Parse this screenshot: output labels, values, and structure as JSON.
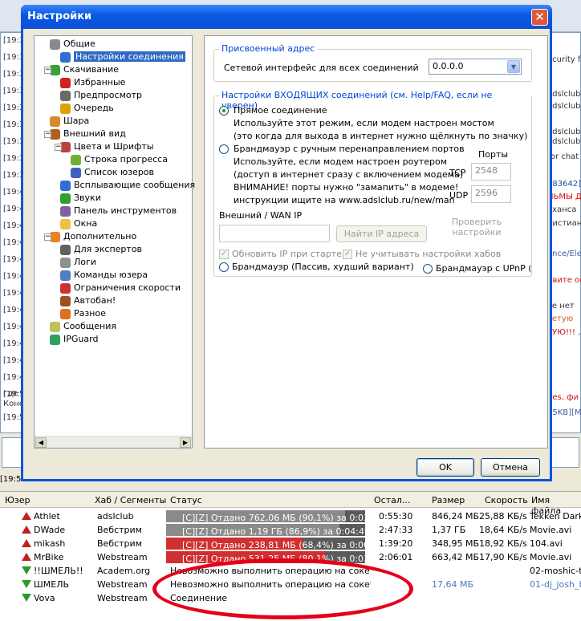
{
  "window": {
    "title": "Настройки",
    "close_glyph": "✕"
  },
  "tree": {
    "items": [
      {
        "label": "Общие",
        "icon": "users-icon",
        "color": "#8a8a8a"
      },
      {
        "label": "Настройки соединения",
        "icon": "network-icon",
        "color": "#2e6fd0",
        "selected": true
      },
      {
        "label": "Скачивание",
        "icon": "download-icon",
        "color": "#3aa03a"
      },
      {
        "label": "Избранные",
        "icon": "heart-icon",
        "color": "#d02020"
      },
      {
        "label": "Предпросмотр",
        "icon": "preview-icon",
        "color": "#6a6a6a"
      },
      {
        "label": "Очередь",
        "icon": "queue-icon",
        "color": "#e0a000"
      },
      {
        "label": "Шара",
        "icon": "share-icon",
        "color": "#d88a2a"
      },
      {
        "label": "Внешний вид",
        "icon": "appearance-icon",
        "color": "#b06020"
      },
      {
        "label": "Цвета и Шрифты",
        "icon": "palette-icon",
        "color": "#c04040"
      },
      {
        "label": "Строка прогресса",
        "icon": "progress-icon",
        "color": "#70b030"
      },
      {
        "label": "Список юзеров",
        "icon": "userlist-icon",
        "color": "#4060c0"
      },
      {
        "label": "Всплывающие сообщения",
        "icon": "popup-icon",
        "color": "#3070d0"
      },
      {
        "label": "Звуки",
        "icon": "sound-icon",
        "color": "#30a030"
      },
      {
        "label": "Панель инструментов",
        "icon": "toolbar-icon",
        "color": "#8060a0"
      },
      {
        "label": "Окна",
        "icon": "windows-icon",
        "color": "#f0c040"
      },
      {
        "label": "Дополнительно",
        "icon": "advanced-icon",
        "color": "#f08020"
      },
      {
        "label": "Для экспертов",
        "icon": "expert-icon",
        "color": "#606060"
      },
      {
        "label": "Логи",
        "icon": "logs-icon",
        "color": "#909090"
      },
      {
        "label": "Команды юзера",
        "icon": "commands-icon",
        "color": "#5080c0"
      },
      {
        "label": "Ограничения скорости",
        "icon": "speed-limit-icon",
        "color": "#d03030"
      },
      {
        "label": "Автобан!",
        "icon": "autoban-icon",
        "color": "#a05020"
      },
      {
        "label": "Разное",
        "icon": "misc-icon",
        "color": "#e07020"
      },
      {
        "label": "Сообщения",
        "icon": "messages-icon",
        "color": "#c0c060"
      },
      {
        "label": "IPGuard",
        "icon": "ipguard-icon",
        "color": "#30a060"
      }
    ]
  },
  "assigned": {
    "title": "Присвоенный адрес",
    "iface_label": "Сетевой интерфейс для всех соединений",
    "iface_value": "0.0.0.0"
  },
  "incoming": {
    "title": "Настройки ВХОДЯЩИХ соединений (см. Help/FAQ, если не уверен)",
    "direct_label": "Прямое соединение",
    "direct_desc1": "Используйте этот режим, если модем настроен мостом",
    "direct_desc2": "(это когда для выхода в интернет нужно щёлкнуть по значку)",
    "firewall_manual_label": "Брандмауэр с ручным перенаправлением портов",
    "fw_desc1": "Используйте, если модем настроен роутером",
    "fw_desc2": "(доступ в интернет сразу с включением модема)",
    "fw_desc3": "ВНИМАНИЕ! порты нужно \"замапить\" в модеме!",
    "fw_desc4": "инструкции ищите на www.adslclub.ru/new/man",
    "ports_label": "Порты",
    "tcp_label": "TCP",
    "tcp_value": "2548",
    "udp_label": "UDP",
    "udp_value": "2596",
    "wan_label": "Внешний / WAN IP",
    "wan_value": "",
    "find_ip_button": "Найти IP адреса",
    "check_settings_button": "Проверить настройки",
    "update_ip_label": "Обновить IP при старте",
    "ignore_hubs_label": "Не учитывать настройки хабов",
    "passive_label": "Брандмауэр (Пассив, худший вариант)",
    "upnp_label": "Брандмауэр с UPnP ("
  },
  "buttons": {
    "ok": "OK",
    "cancel": "Отмена"
  },
  "transfers": {
    "columns": [
      "Юзер",
      "Хаб / Сегменты",
      "Статус",
      "Остал...",
      "Размер",
      "Скорость",
      "Имя файла"
    ],
    "rows": [
      {
        "user": "Athlet",
        "hub": "adslclub",
        "status": "[C][Z] Отдано 762,06 МБ (90,1%) за 0:03:30",
        "left": "0:55:30",
        "size": "846,24 МБ",
        "speed": "25,88 КБ/s",
        "file": "Tekken Dark R",
        "dir": "up",
        "progress": 0.901,
        "bar_color": "#8a8a8a"
      },
      {
        "user": "DWade",
        "hub": "Вебстрим",
        "status": "[C][Z] Отдано 1,19 ГБ (86,9%) за 0:04:49",
        "left": "2:47:33",
        "size": "1,37 ГБ",
        "speed": "18,64 КБ/s",
        "file": "Movie.avi",
        "dir": "up",
        "progress": 0.869,
        "bar_color": "#8a8a8a"
      },
      {
        "user": "mikash",
        "hub": "Вебстрим",
        "status": "[C][Z] Отдано 238,81 МБ (68,4%) за 0:00:44",
        "left": "1:39:20",
        "size": "348,95 МБ",
        "speed": "18,92 КБ/s",
        "file": "104.avi",
        "dir": "up",
        "progress": 0.684,
        "bar_color": "#d03030"
      },
      {
        "user": "MrBike",
        "hub": "Webstream",
        "status": "[C][Z] Отдано 531,25 МБ (80,1%) за 0:03:08",
        "left": "2:06:01",
        "size": "663,42 МБ",
        "speed": "17,90 КБ/s",
        "file": "Movie.avi",
        "dir": "up",
        "progress": 0.801,
        "bar_color": "#d03030"
      },
      {
        "user": "!!ШМЕЛЬ!!",
        "hub": "Academ.org",
        "status": "Невозможно выполнить операцию на сокете...",
        "left": "",
        "size": "",
        "speed": "",
        "file": "02-moshic-the",
        "dir": "down"
      },
      {
        "user": "ШМЕЛЬ",
        "hub": "Webstream",
        "status": "Невозможно выполнить операцию на сокете...",
        "left": "",
        "size": "17,64 МБ",
        "speed": "",
        "file": "01-dj_josh_bl",
        "dir": "down"
      },
      {
        "user": "Vova",
        "hub": "Webstream",
        "status": "Соединение",
        "left": "",
        "size": "",
        "speed": "",
        "file": "",
        "dir": "down"
      }
    ]
  },
  "background": {
    "chat_times": [
      "[19:3",
      "[19:3",
      "[19:3",
      "[19:3",
      "[19:3",
      "[19:3",
      "[19:3",
      "[19:3",
      "[19:3",
      "[19:4",
      "[19:4",
      "[19:4",
      "[19:4",
      "[19:4",
      "[19:4",
      "[19:4",
      "[19:4",
      "[19:4",
      "[19:4",
      "[19:4",
      "[19:4",
      "[19:5"
    ],
    "right_fragments": [
      "ecurity f",
      "adslclub",
      "adslclub",
      "adslclub",
      "adslclub",
      "tor chat",
      "483642]",
      "ЛЬМЫ Д",
      "аханса",
      "ристиан",
      "ance/Elec",
      "ивите ос",
      "че нет",
      "ветую",
      "ТУЮ!!! ,",
      "nes, фи",
      "55KB][M"
    ],
    "bottom_left_1": "где и",
    "bottom_left_2": "Конс",
    "bottom_left_3": "[19:5",
    "status_bar": "[19:5"
  }
}
